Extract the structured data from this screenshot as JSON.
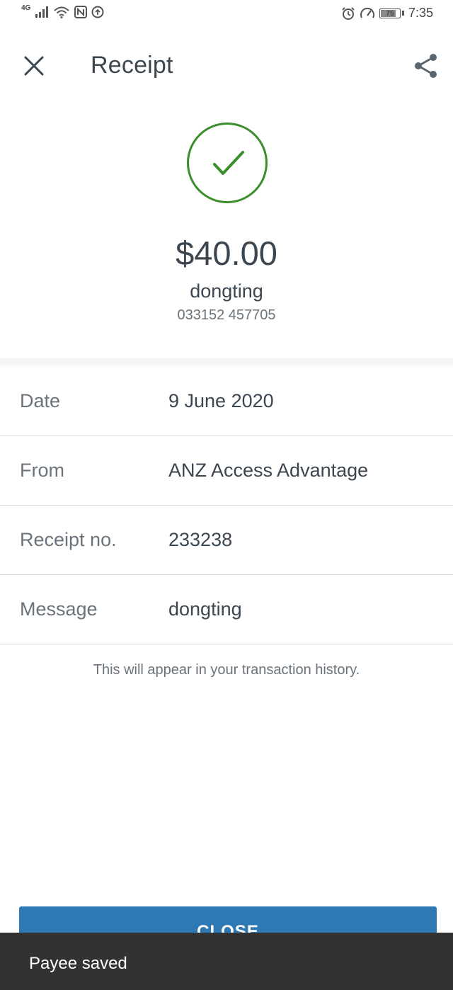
{
  "status_bar": {
    "network": "4G",
    "battery": "75",
    "time": "7:35"
  },
  "header": {
    "title": "Receipt"
  },
  "summary": {
    "amount": "$40.00",
    "payee": "dongting",
    "account": "033152 457705"
  },
  "details": [
    {
      "label": "Date",
      "value": "9 June 2020"
    },
    {
      "label": "From",
      "value": "ANZ Access Advantage"
    },
    {
      "label": "Receipt no.",
      "value": "233238"
    },
    {
      "label": "Message",
      "value": "dongting"
    }
  ],
  "note": "This will appear in your transaction history.",
  "close_button": {
    "label": "CLOSE"
  },
  "snackbar": {
    "message": "Payee saved"
  },
  "colors": {
    "success_green": "#3a8f2a",
    "primary_blue": "#2e79b4",
    "snackbar_bg": "#323232",
    "text_dark": "#3b4650",
    "text_muted": "#6a737b"
  },
  "icons": {
    "close": "close-icon",
    "share": "share-icon",
    "success": "check-circle-icon"
  }
}
